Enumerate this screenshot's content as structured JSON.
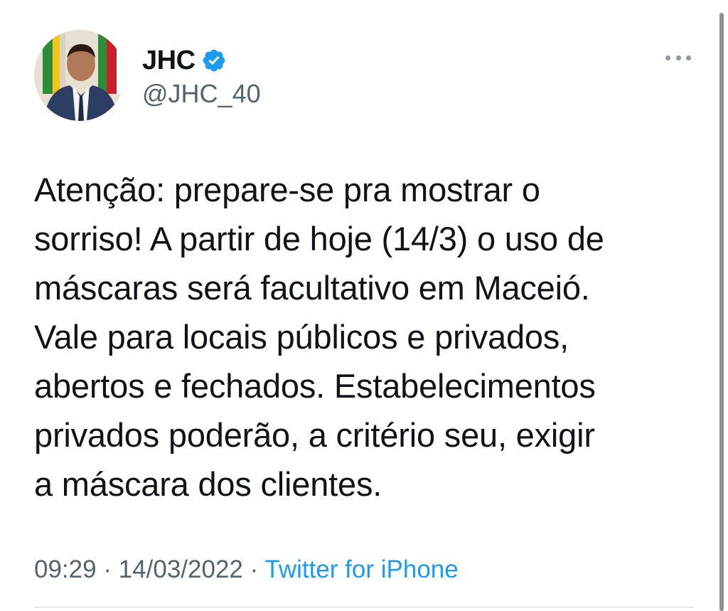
{
  "author": {
    "display_name": "JHC",
    "handle": "@JHC_40",
    "verified_icon": "verified-badge-icon",
    "verified_color": "#1d9bf0"
  },
  "tweet": {
    "lines": [
      "Atenção: prepare-se pra mostrar o",
      "sorriso! A partir de hoje (14/3) o uso de",
      "máscaras será facultativo em Maceió.",
      "Vale para locais públicos e privados,",
      "abertos e fechados. Estabelecimentos",
      "privados poderão, a critério seu, exigir",
      "a máscara dos clientes."
    ]
  },
  "meta": {
    "time": "09:29",
    "separator": "·",
    "date": "14/03/2022",
    "source": "Twitter for iPhone"
  },
  "colors": {
    "text": "#0f1419",
    "secondary": "#536471",
    "link": "#1d9bf0"
  }
}
